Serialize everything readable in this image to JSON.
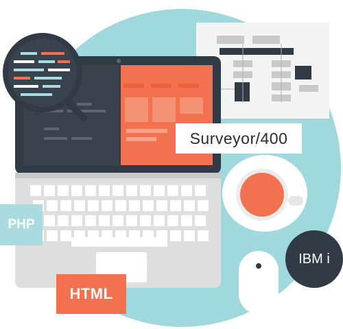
{
  "labels": {
    "surveyor": "Surveyor/400",
    "php": "PHP",
    "html": "HTML",
    "ibmi": "IBM i"
  },
  "colors": {
    "background_circle": "#9fd9de",
    "laptop_body": "#dfdfdf",
    "screen_dark": "#303b45",
    "accent_orange": "#f2714f",
    "light_blue": "#a9dbe0",
    "flowchart_paper": "#f4f4f4"
  },
  "icons": [
    "laptop-icon",
    "magnifier-code-icon",
    "flowchart-icon",
    "coffee-cup-icon",
    "mouse-icon"
  ]
}
